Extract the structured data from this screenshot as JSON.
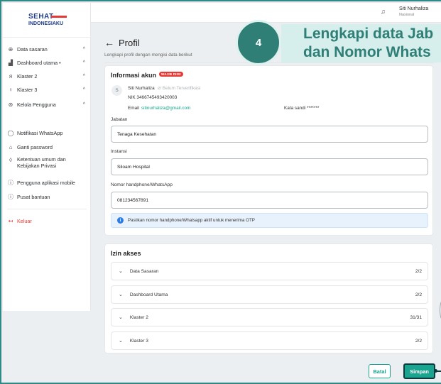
{
  "brand": {
    "line1": "SEHAT",
    "line2": "INDONESIAKU"
  },
  "sidebar": {
    "items": [
      {
        "label": "Data sasaran",
        "icon": "target-icon",
        "chevron": "^"
      },
      {
        "label": "Dashboard utama •",
        "icon": "chart-icon",
        "chevron": "^"
      },
      {
        "label": "Klaster 2",
        "icon": "group-icon",
        "chevron": "^"
      },
      {
        "label": "Klaster 3",
        "icon": "person-icon",
        "chevron": "^"
      },
      {
        "label": "Kelola Pengguna",
        "icon": "user-cog-icon",
        "chevron": "^"
      }
    ],
    "links": [
      {
        "label": "Notifikasi WhatsApp",
        "icon": "chat-icon"
      },
      {
        "label": "Ganti password",
        "icon": "lock-icon"
      },
      {
        "label": "Ketentuan umum dan",
        "label2": "Kebijakan Privasi",
        "icon": "shield-icon"
      },
      {
        "label": "Pengguna aplikasi mobile",
        "icon": "info-icon"
      },
      {
        "label": "Pusat bantuan",
        "icon": "help-icon"
      }
    ],
    "logout": "Keluar"
  },
  "topbar": {
    "user_name": "Siti Nurhaliza",
    "user_role": "Nasional"
  },
  "page": {
    "title": "Profil",
    "subtitle": "Lengkapi profil dengan mengisi data berikut"
  },
  "account": {
    "section_title": "Informasi akun",
    "badge": "WAJIB DIISI",
    "avatar_initial": "S",
    "name": "Siti Nurhaliza",
    "verify_status": "Belum Terverifikasi",
    "nik": "NIK 3466745493420003",
    "email_label": "Email",
    "email": "sitinurhaliza@gmail.com",
    "password_label": "Kata sandi *******"
  },
  "form": {
    "jabatan_label": "Jabatan",
    "jabatan_value": "Tenaga Kesehatan",
    "instansi_label": "Instansi",
    "instansi_value": "Siloam Hospital",
    "phone_label": "Nomor handphone/WhatsApp",
    "phone_value": "081234567891",
    "info": "Pastikan nomor handphone/Whatsapp aktif untuk menerima OTP"
  },
  "permissions": {
    "title": "Izin akses",
    "rows": [
      {
        "label": "Data Sasaran",
        "count": "2/2"
      },
      {
        "label": "Dashboard Utama",
        "count": "2/2"
      },
      {
        "label": "Klaster 2",
        "count": "31/31"
      },
      {
        "label": "Klaster 3",
        "count": "2/2"
      }
    ]
  },
  "actions": {
    "cancel": "Batal",
    "save": "Simpan"
  },
  "step": {
    "number": "4",
    "line1": "Lengkapi data Jab",
    "line2": "dan Nomor Whats"
  },
  "colors": {
    "accent": "#1aa38f",
    "step": "#2f7f76",
    "danger": "#e53935"
  }
}
